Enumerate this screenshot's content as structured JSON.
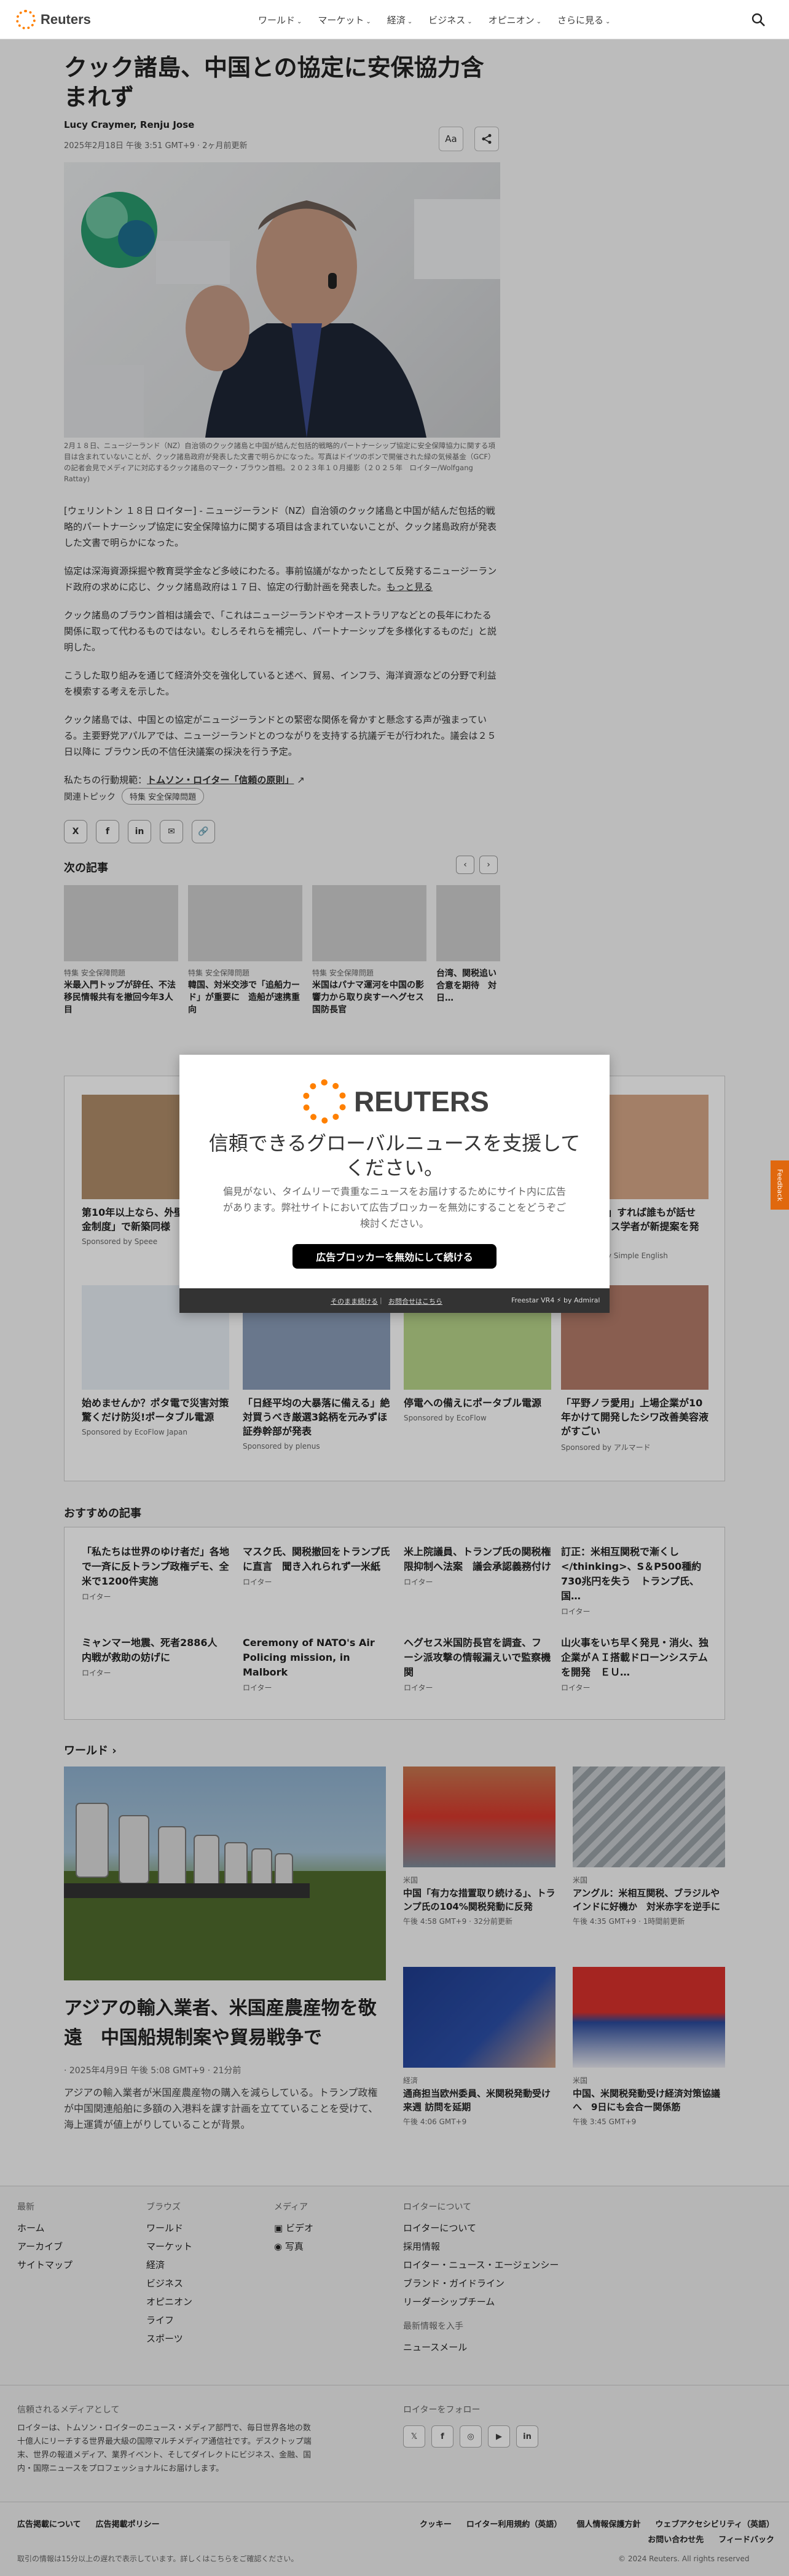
{
  "nav": {
    "logo": "Reuters",
    "items": [
      "ワールド",
      "マーケット",
      "経済",
      "ビジネス",
      "オピニオン",
      "さらに見る"
    ]
  },
  "article": {
    "title": "クック諸島、中国との協定に安保協力含まれず",
    "authors": "Lucy Craymer, Renju Jose",
    "date": "2025年2月18日 午後 3:51 GMT+9 · 2ヶ月前更新",
    "font_button": "Aa",
    "caption": "2月１８日、ニュージーランド（NZ）自治領のクック諸島と中国が結んだ包括的戦略的パートナーシップ協定に安全保障協力に関する項目は含まれていないことが、クック諸島政府が発表した文書で明らかになった。写真はドイツのボンで開催された緑の気候基金（GCF）の記者会見でメディアに対応するクック諸島のマーク・ブラウン首相。２０２３年１０月撮影（２０２５年　ロイター/Wolfgang Rattay)",
    "paragraphs": [
      "[ウェリントン １８日 ロイター] - ニュージーランド（NZ）自治領のクック諸島と中国が結んだ包括的戦略的パートナーシップ協定に安全保障協力に関する項目は含まれていないことが、クック諸島政府が発表した文書で明らかになった。",
      "協定は深海資源採掘や教育奨学金など多岐にわたる。事前協議がなかったとして反発するニュージーランド政府の求めに応じ、クック諸島政府は１７日、協定の行動計画を発表した。",
      "クック諸島のブラウン首相は議会で、「これはニュージーランドやオーストラリアなどとの長年にわたる関係に取って代わるものではない。むしろそれらを補完し、パートナーシップを多様化するものだ」と説明した。",
      "こうした取り組みを通じて経済外交を強化していると述べ、貿易、インフラ、海洋資源などの分野で利益を模索する考えを示した。",
      "クック諸島では、中国との協定がニュージーランドとの緊密な関係を脅かすと懸念する声が強まっている。主要野党アパルアでは、ニュージーランドとのつながりを支持する抗議デモが行われた。議会は２５日以降に ブラウン氏の不信任決議案の採決を行う予定。"
    ],
    "more_link": "もっと見る",
    "principles_prefix": "私たちの行動規範：",
    "principles_link": "トムソン・ロイター「信頼の原則」",
    "topics_label": "関連トピック",
    "topic_pill": "特集 安全保障問題",
    "share": [
      "X",
      "f",
      "in",
      "✉",
      "🔗"
    ]
  },
  "next": {
    "title": "次の記事",
    "cards": [
      {
        "kicker": "特集 安全保障問題",
        "title": "米最入門トップが辞任、不法移民情報共有を撤回今年3人目"
      },
      {
        "kicker": "特集 安全保障問題",
        "title": "韓国、対米交渉で「追船力ード」が重要に　造船が速携重向"
      },
      {
        "kicker": "特集 安全保障問題",
        "title": "米国はパナマ運河を中国の影響力から取り戻すーヘグセス国防長官"
      },
      {
        "kicker": "",
        "title": "台湾、関税追い合意を期待　対日…"
      }
    ]
  },
  "ads": [
    {
      "title": "第10年以上なら、外壁に「助成金制度」で新築同様",
      "sponsor": "Sponsored by Speee"
    },
    {
      "title": "",
      "sponsor": ""
    },
    {
      "title": "",
      "sponsor": ""
    },
    {
      "title": "「1文暗記」すれば誰もが話せる!?イギリス学者が新提案を発表",
      "sponsor": "Sponsored by Simple English"
    },
    {
      "title": "始めませんか？ポタ電で災害対策 驚くだけ防災!ポータブル電源",
      "sponsor": "Sponsored by EcoFlow Japan"
    },
    {
      "title": "「日経平均の大暴落に備える」絶対買うべき厳選3銘柄を元みずほ証券幹部が発表",
      "sponsor": "Sponsored by plenus"
    },
    {
      "title": "停電への備えにポータブル電源",
      "sponsor": "Sponsored by EcoFlow"
    },
    {
      "title": "「平野ノラ愛用」上場企業が10年かけて開発したシワ改善美容液がすごい",
      "sponsor": "Sponsored by アルマード"
    }
  ],
  "modal": {
    "logo": "REUTERS",
    "heading": "信頼できるグローバルニュースを支援してください。",
    "message": "偏見がない、タイムリーで貴重なニュースをお届けするためにサイト内に広告があります。弊社サイトにおいて広告ブロッカーを無効にすることをどうぞご検討ください。",
    "cta": "広告ブロッカーを無効にして続ける",
    "foot_left": "そのまま続ける",
    "foot_mid": "お問合せはこちら",
    "foot_right": "Freestar VR4 ⚡ by Admiral"
  },
  "recommended": {
    "title": "おすすめの記事",
    "items": [
      {
        "title": "「私たちは世界のゆけ者だ」各地で一斉に反トランプ政権デモ、全米で1200件実施",
        "source": "ロイター"
      },
      {
        "title": "マスク氏、関税撤回をトランプ氏に直言　聞き入れられず一米紙",
        "source": "ロイター"
      },
      {
        "title": "米上院議員、トランプ氏の関税権限抑制へ法案　議会承認義務付け",
        "source": "ロイター"
      },
      {
        "title": "訂正：米相互関税で漸くし</thinking>、S＆P500種約730兆円を失う　トランプ氏、国…",
        "source": "ロイター"
      },
      {
        "title": "ミャンマー地震、死者2886人　内戦が救助の妨げに",
        "source": "ロイター"
      },
      {
        "title": "Ceremony of NATO's Air Policing mission, in Malbork",
        "source": "ロイター"
      },
      {
        "title": "ヘグセス米国防長官を調査、フーシ派攻撃の情報漏えいで監察機関",
        "source": "ロイター"
      },
      {
        "title": "山火事をいち早く発見・消火、独企業がＡＩ搭載ドローンシステムを開発　ＥＵ…",
        "source": "ロイター"
      }
    ]
  },
  "world": {
    "title": "ワールド",
    "lead_title": "アジアの輸入業者、米国産農産物を敬遠　中国船規制案や貿易戦争で",
    "lead_date": "· 2025年4月9日 午後 5:08 GMT+9 · 21分前",
    "lead_text": "アジアの輸入業者が米国産農産物の購入を減らしている。トランプ政権が中国関連船舶に多額の入港料を課す計画を立てていることを受けて、海上運賃が値上がりしていることが背景。",
    "cards": [
      {
        "kicker": "米国",
        "title": "中国「有力な措置取り続ける」、トランプ氏の104%関税発動に反発",
        "time": "午後 4:58 GMT+9 · 32分前更新"
      },
      {
        "kicker": "米国",
        "title": "アングル：米相互関税、ブラジルやインドに好機か　対米赤字を逆手に",
        "time": "午後 4:35 GMT+9 · 1時間前更新"
      },
      {
        "kicker": "経済",
        "title": "通商担当欧州委員、米関税発動受け来週 訪問を延期",
        "time": "午後 4:06 GMT+9"
      },
      {
        "kicker": "米国",
        "title": "中国、米関税発動受け経済対策協議へ　9日にも会合ー関係筋",
        "time": "午後 3:45 GMT+9"
      }
    ]
  },
  "footer": {
    "col1": {
      "head": "最新",
      "items": [
        "ホーム",
        "アーカイブ",
        "サイトマップ"
      ]
    },
    "col2": {
      "head": "ブラウズ",
      "items": [
        "ワールド",
        "マーケット",
        "経済",
        "ビジネス",
        "オピニオン",
        "ライフ",
        "スポーツ"
      ]
    },
    "col3": {
      "head": "メディア",
      "items": [
        "ビデオ",
        "写真"
      ]
    },
    "col4": {
      "head": "ロイターについて",
      "items": [
        "ロイターについて",
        "採用情報",
        "ロイター・ニュース・エージェンシー",
        "ブランド・ガイドライン",
        "リーダーシップチーム"
      ]
    },
    "col4b": {
      "head": "最新情報を入手",
      "items": [
        "ニュースメール"
      ]
    },
    "trusted_head": "信頼されるメディアとして",
    "trusted_text": "ロイターは、トムソン・ロイターのニュース・メディア部門で、毎日世界各地の数十億人にリーチする世界最大級の国際マルチメディア通信社です。デスクトップ端末、世界の報道メディア、業界イベント、そしてダイレクトにビジネス、金融、国内・国際ニュースをプロフェッショナルにお届けします。",
    "follow_head": "ロイターをフォロー",
    "social": [
      "𝕏",
      "f",
      "◎",
      "▶",
      "in"
    ],
    "bottom_left": [
      "広告掲載について",
      "広告掲載ポリシー"
    ],
    "bottom_right": [
      "クッキー",
      "ロイター利用規約（英語）",
      "個人情報保護方針",
      "ウェブアクセシビリティ（英語）",
      "お問い合わせ先",
      "フィードバック"
    ],
    "notice": "取引の情報は15分以上の遅れで表示しています。詳しくはこちらをご確認ください。",
    "copyright": "© 2024 Reuters. All rights reserved"
  },
  "feedback": "Feedback",
  "colors": {
    "accent": "#ff8000",
    "feedback": "#e0680e"
  }
}
